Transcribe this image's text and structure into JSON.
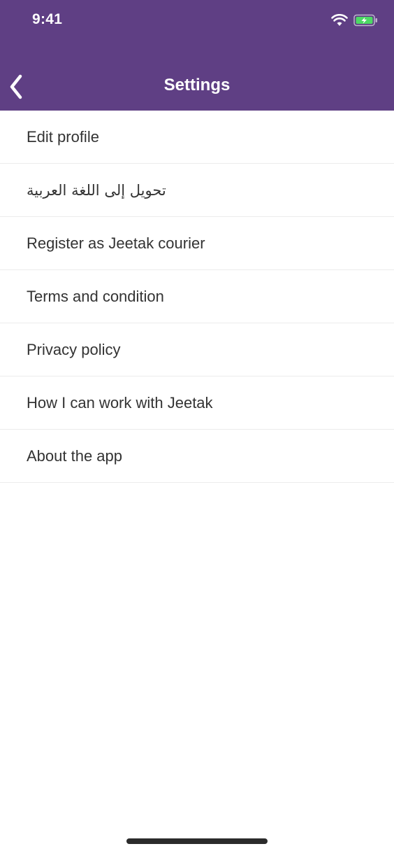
{
  "status_bar": {
    "time": "9:41",
    "icons": [
      "wifi-icon",
      "battery-charging-icon"
    ],
    "battery_color": "#4cd964"
  },
  "nav": {
    "title": "Settings",
    "back_icon": "chevron-left-icon"
  },
  "colors": {
    "header_background": "#5f3f84",
    "header_text": "#ffffff",
    "item_text": "#333333",
    "divider": "#ececec"
  },
  "menu": {
    "items": [
      {
        "label": "Edit profile"
      },
      {
        "label": "تحويل إلى اللغة العربية"
      },
      {
        "label": "Register as Jeetak courier"
      },
      {
        "label": "Terms and condition"
      },
      {
        "label": "Privacy policy"
      },
      {
        "label": "How I can work with Jeetak"
      },
      {
        "label": "About the app"
      }
    ]
  }
}
